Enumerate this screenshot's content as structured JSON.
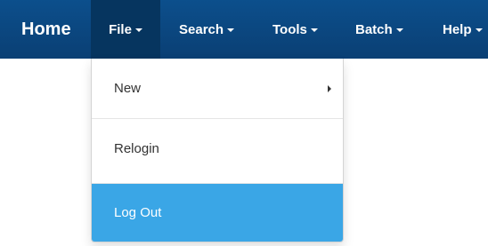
{
  "navbar": {
    "brand": "Home",
    "items": [
      {
        "label": "File"
      },
      {
        "label": "Search"
      },
      {
        "label": "Tools"
      },
      {
        "label": "Batch"
      },
      {
        "label": "Help"
      }
    ]
  },
  "file_menu": {
    "items": [
      {
        "label": "New",
        "has_submenu": true
      },
      {
        "label": "Relogin"
      },
      {
        "label": "Log Out",
        "highlighted": true
      }
    ]
  },
  "colors": {
    "navbar_bg": "#0a4680",
    "active_item_bg": "#06355f",
    "highlight_bg": "#3aa6e6"
  }
}
